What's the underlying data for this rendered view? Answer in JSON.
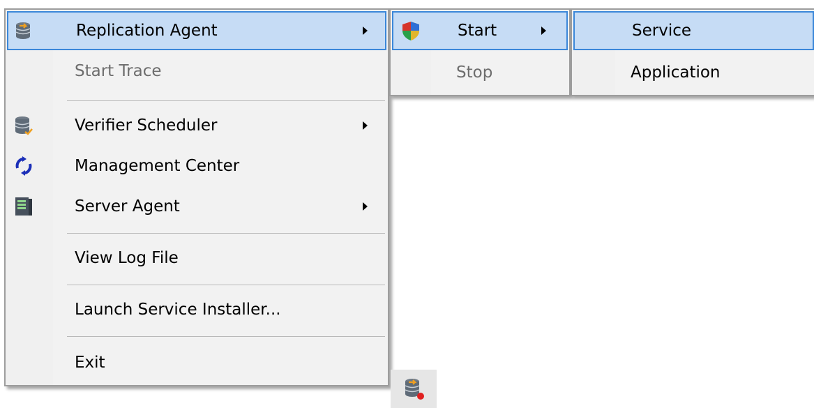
{
  "main_menu": {
    "items": [
      {
        "label": "Replication Agent",
        "icon": "database-arrow-icon",
        "submenu": true,
        "highlighted": true,
        "enabled": true
      },
      {
        "label": "Start Trace",
        "enabled": false
      },
      {
        "label": "Verifier Scheduler",
        "icon": "database-check-icon",
        "submenu": true,
        "enabled": true
      },
      {
        "label": "Management Center",
        "icon": "sync-arrows-icon",
        "enabled": true
      },
      {
        "label": "Server Agent",
        "icon": "server-icon",
        "submenu": true,
        "enabled": true
      },
      {
        "label": "View Log File",
        "enabled": true
      },
      {
        "label": "Launch Service Installer...",
        "enabled": true
      },
      {
        "label": "Exit",
        "enabled": true
      }
    ]
  },
  "agent_submenu": {
    "items": [
      {
        "label": "Start",
        "icon": "shield-icon",
        "submenu": true,
        "highlighted": true,
        "enabled": true
      },
      {
        "label": "Stop",
        "enabled": false
      }
    ]
  },
  "start_submenu": {
    "items": [
      {
        "label": "Service",
        "highlighted": true,
        "enabled": true
      },
      {
        "label": "Application",
        "enabled": true
      }
    ]
  },
  "tray": {
    "icon": "replication-tray-icon"
  },
  "colors": {
    "highlight_bg": "#c6dcf5",
    "highlight_border": "#3b87d9",
    "menu_bg": "#f2f2f2",
    "disabled_text": "#6d6d6d"
  }
}
